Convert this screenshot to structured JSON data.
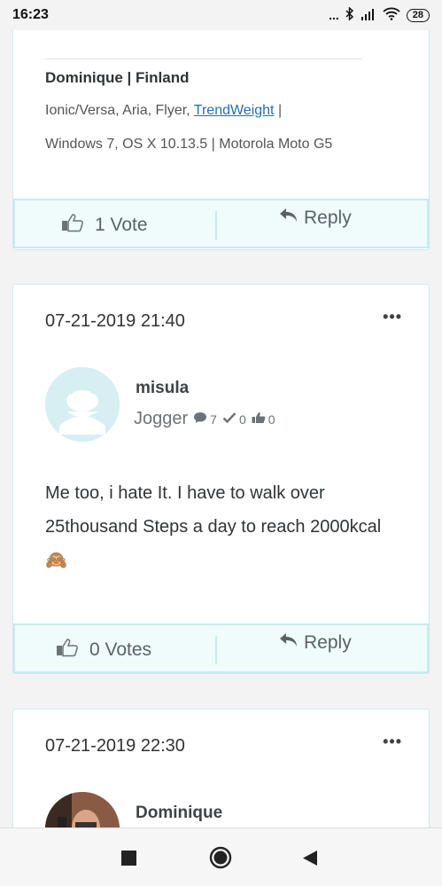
{
  "status": {
    "time": "16:23",
    "dots": "...",
    "battery": "28"
  },
  "post_prev": {
    "signature_name": "Dominique | Finland",
    "sig_line1_pre": "Ionic/Versa, Aria, Flyer, ",
    "sig_link": "TrendWeight",
    "sig_line1_post": " |",
    "sig_line2": "Windows 7, OS X 10.13.5 | Motorola Moto G5",
    "votes": "1 Vote",
    "reply": "Reply"
  },
  "post_main": {
    "date": "07-21-2019 21:40",
    "more": "•••",
    "author": "misula",
    "rank": "Jogger",
    "stats": {
      "messages": "7",
      "solutions": "0",
      "kudos": "0"
    },
    "body": "Me too, i hate It. I have to walk over 25thousand Steps a day to reach 2000kcal 🙈",
    "votes": "0 Votes",
    "reply": "Reply"
  },
  "post_next": {
    "date": "07-21-2019 22:30",
    "more": "•••",
    "author": "Dominique"
  },
  "icons": {
    "thumbs_up": "thumbs-up-icon",
    "reply": "reply-arrow-icon",
    "message": "speech-bubble-icon",
    "check": "checkmark-icon",
    "kudos": "thumbs-up-small-icon"
  },
  "colors": {
    "accent_border": "#c8ebef",
    "vote_bg": "#f0fbfc",
    "link": "#1f6fb5"
  }
}
